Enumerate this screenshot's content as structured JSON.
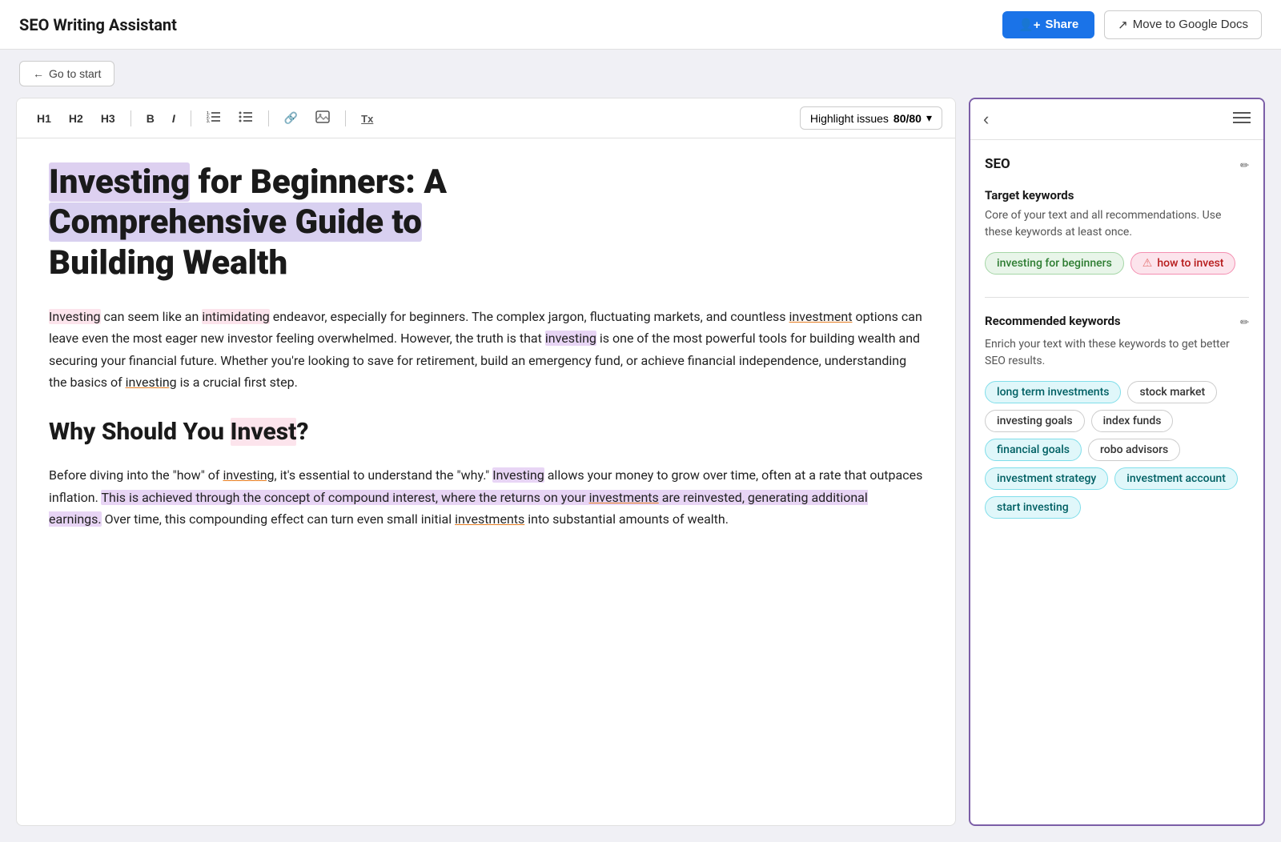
{
  "header": {
    "title": "SEO Writing Assistant",
    "share_label": "Share",
    "move_label": "Move to Google Docs"
  },
  "sub_header": {
    "go_start_label": "Go to start"
  },
  "toolbar": {
    "h1": "H1",
    "h2": "H2",
    "h3": "H3",
    "bold": "B",
    "italic": "I",
    "ordered_list": "≡",
    "unordered_list": "⁝",
    "link": "🔗",
    "image": "🖼",
    "clear": "Tx",
    "highlight_label": "Highlight issues",
    "score": "80/80",
    "dropdown_arrow": "▾"
  },
  "editor": {
    "title_part1": "Investing",
    "title_part2": " for Beginners: A ",
    "title_part3": "Comprehensive Guide to",
    "title_part4": " Building Wealth",
    "para1": "Investing can seem like an intimidating endeavor, especially for beginners. The complex jargon, fluctuating markets, and countless investment options can leave even the most eager new investor feeling overwhelmed. However, the truth is that investing is one of the most powerful tools for building wealth and securing your financial future. Whether you're looking to save for retirement, build an emergency fund, or achieve financial independence, understanding the basics of investing is a crucial first step.",
    "h2": "Why Should You Invest?",
    "para2": "Before diving into the \"how\" of investing, it's essential to understand the \"why.\" Investing allows your money to grow over time, often at a rate that outpaces inflation. This is achieved through the concept of compound interest, where the returns on your investments are reinvested, generating additional earnings. Over time, this compounding effect can turn even small initial investments into substantial amounts of wealth."
  },
  "right_panel": {
    "topbar": {
      "back_arrow": "‹",
      "menu_icon": "☰"
    },
    "seo_section": {
      "title": "SEO",
      "edit_icon": "✏"
    },
    "target_keywords": {
      "title": "Target keywords",
      "description": "Core of your text and all recommendations. Use these keywords at least once.",
      "keywords": [
        {
          "label": "investing for beginners",
          "type": "green"
        },
        {
          "label": "⚠ how to invest",
          "type": "red"
        }
      ]
    },
    "recommended_keywords": {
      "title": "Recommended keywords",
      "edit_icon": "✏",
      "description": "Enrich your text with these keywords to get better SEO results.",
      "keywords": [
        {
          "label": "long term investments",
          "type": "teal"
        },
        {
          "label": "stock market",
          "type": "outline"
        },
        {
          "label": "investing goals",
          "type": "outline"
        },
        {
          "label": "index funds",
          "type": "outline"
        },
        {
          "label": "financial goals",
          "type": "teal"
        },
        {
          "label": "robo advisors",
          "type": "outline"
        },
        {
          "label": "investment strategy",
          "type": "teal"
        },
        {
          "label": "investment account",
          "type": "teal"
        },
        {
          "label": "start investing",
          "type": "teal"
        }
      ]
    }
  }
}
